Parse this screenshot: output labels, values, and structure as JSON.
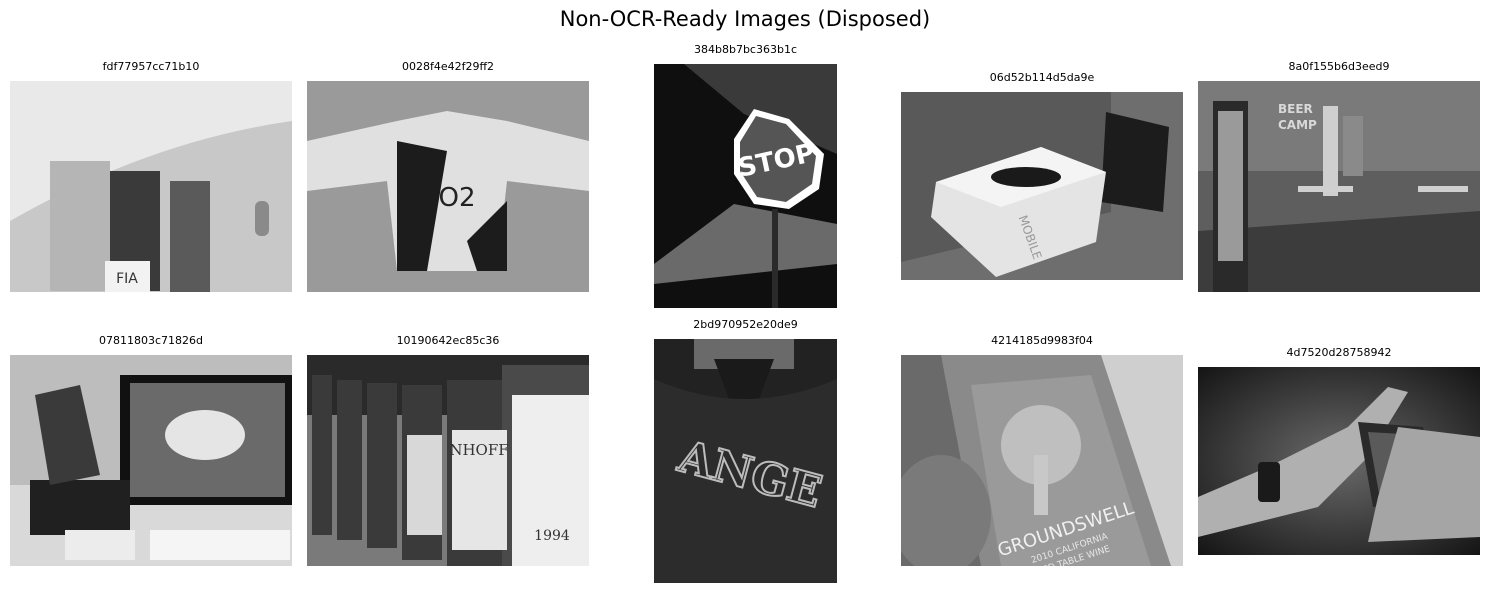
{
  "figure": {
    "title": "Non-OCR-Ready Images (Disposed)"
  },
  "images": [
    {
      "label": "fdf77957cc71b10",
      "scene": "airplane-door-camera-crew",
      "tone": "light",
      "visible_text": [
        "FIA"
      ]
    },
    {
      "label": "0028f4e42f29ff2",
      "scene": "rugby-shirt",
      "tone": "mid",
      "visible_text": [
        "O2"
      ]
    },
    {
      "label": "384b8b7bc363b1c",
      "scene": "stop-sign-at-night",
      "tone": "dark",
      "visible_text": [
        "STOP"
      ]
    },
    {
      "label": "06d52b114d5da9e",
      "scene": "product-box-on-table",
      "tone": "mid",
      "visible_text": [
        "MOBILE"
      ]
    },
    {
      "label": "8a0f155b6d3eed9",
      "scene": "office-interior-mural",
      "tone": "mid",
      "visible_text": [
        "BEER",
        "CAMP"
      ]
    },
    {
      "label": "07811803c71826d",
      "scene": "desk-with-monitor-and-laptop",
      "tone": "light",
      "visible_text": []
    },
    {
      "label": "10190642ec85c36",
      "scene": "row-of-wine-bottles",
      "tone": "mid",
      "visible_text": [
        "NHOFF",
        "1994"
      ]
    },
    {
      "label": "2bd970952e20de9",
      "scene": "jersey-lettering-closeup",
      "tone": "dark",
      "visible_text": [
        "ANGE"
      ]
    },
    {
      "label": "4214185d9983f04",
      "scene": "wine-bottle-label",
      "tone": "mid",
      "visible_text": [
        "GROUNDSWELL",
        "2010 CALIFORNIA",
        "RED TABLE WINE"
      ]
    },
    {
      "label": "4d7520d28758942",
      "scene": "hands-holding-phone",
      "tone": "dark",
      "visible_text": []
    }
  ]
}
